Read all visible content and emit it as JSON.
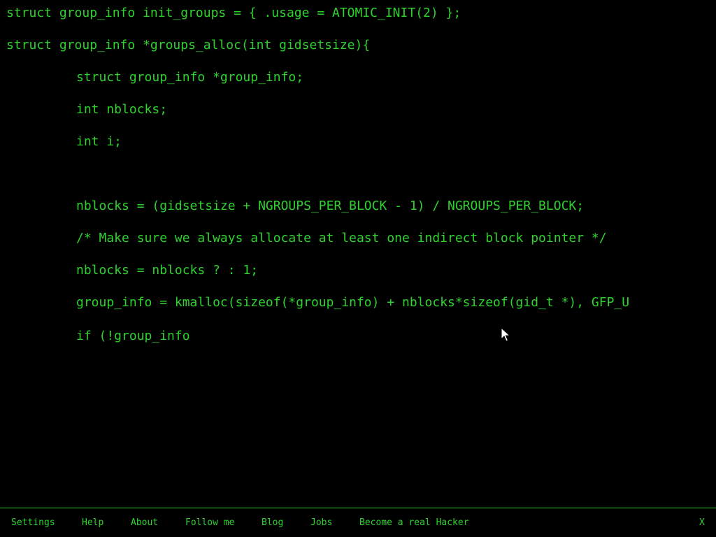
{
  "code": {
    "lines": [
      "struct group_info init_groups = { .usage = ATOMIC_INIT(2) };",
      "struct group_info *groups_alloc(int gidsetsize){",
      "struct group_info *group_info;",
      "int nblocks;",
      "int i;",
      "nblocks = (gidsetsize + NGROUPS_PER_BLOCK - 1) / NGROUPS_PER_BLOCK;",
      "/* Make sure we always allocate at least one indirect block pointer */",
      "nblocks = nblocks ? : 1;",
      "group_info = kmalloc(sizeof(*group_info) + nblocks*sizeof(gid_t *), GFP_U",
      "if (!group_info"
    ]
  },
  "footer": {
    "settings": "Settings",
    "help": "Help",
    "about": "About",
    "follow_me": "Follow me",
    "blog": "Blog",
    "jobs": "Jobs",
    "become_hacker": "Become a real Hacker",
    "close": "X"
  },
  "colors": {
    "text": "#2ed12e",
    "background": "#000000"
  },
  "icons": {
    "cursor": "mouse-pointer-icon"
  }
}
